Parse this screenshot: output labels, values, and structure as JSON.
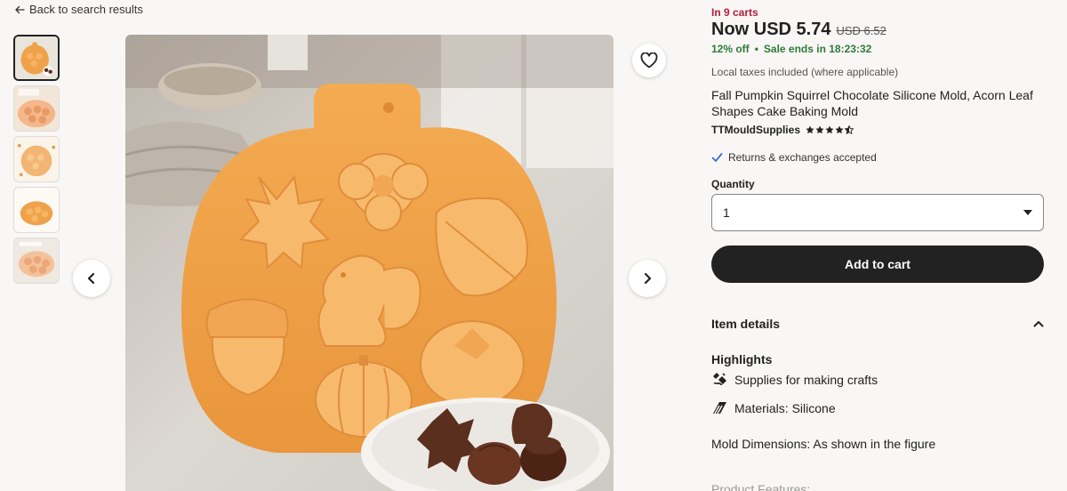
{
  "nav": {
    "back_label": "Back to search results"
  },
  "thumbnails": [
    {
      "alt": "thumbnail-1"
    },
    {
      "alt": "thumbnail-2"
    },
    {
      "alt": "thumbnail-3"
    },
    {
      "alt": "thumbnail-4"
    },
    {
      "alt": "thumbnail-5"
    }
  ],
  "product": {
    "in_carts": "In 9 carts",
    "price_now": "Now USD 5.74",
    "price_old": "USD 6.52",
    "discount": "12% off",
    "sale_dot": "•",
    "sale_ends": "Sale ends in 18:23:32",
    "taxes": "Local taxes included (where applicable)",
    "title": "Fall Pumpkin Squirrel Chocolate Silicone Mold, Acorn Leaf Shapes Cake Baking Mold",
    "shop_name": "TTMouldSupplies",
    "rating": 4.5,
    "returns": "Returns & exchanges accepted",
    "quantity_label": "Quantity",
    "quantity_value": "1",
    "add_to_cart": "Add to cart",
    "item_details": "Item details",
    "highlights_heading": "Highlights",
    "highlights": [
      {
        "icon": "crafts-icon",
        "text": "Supplies for making crafts"
      },
      {
        "icon": "material-icon",
        "text": "Materials: Silicone"
      }
    ],
    "dimensions": "Mold Dimensions: As shown in the figure",
    "features_label": "Product Features:"
  },
  "colors": {
    "accent_red": "#b2213a",
    "sale_green": "#2f7a3a",
    "button_dark": "#222222",
    "mold_orange": "#f0a24a"
  }
}
